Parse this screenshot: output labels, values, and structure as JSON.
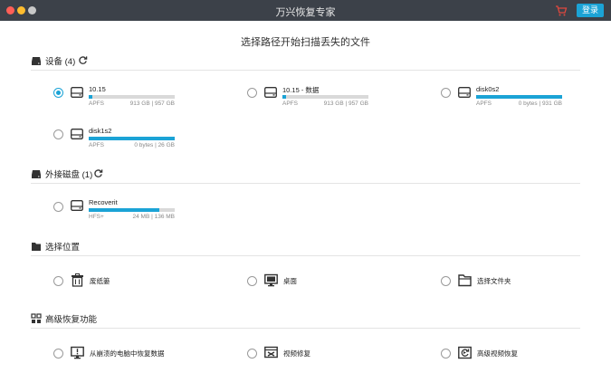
{
  "window": {
    "title": "万兴恢复专家",
    "login_label": "登录"
  },
  "page": {
    "heading": "选择路径开始扫描丢失的文件"
  },
  "sections": {
    "devices": {
      "label": "设备 (4)"
    },
    "external": {
      "label": "外接磁盘 (1)"
    },
    "locations": {
      "label": "选择位置"
    },
    "advanced": {
      "label": "高级恢复功能"
    }
  },
  "devices": [
    {
      "name": "10.15",
      "fs": "APFS",
      "size": "913 GB | 957 GB",
      "used_fraction": 0.04,
      "selected": true
    },
    {
      "name": "10.15 - 数据",
      "fs": "APFS",
      "size": "913 GB | 957 GB",
      "used_fraction": 0.04,
      "selected": false
    },
    {
      "name": "disk0s2",
      "fs": "APFS",
      "size": "0 bytes | 931 GB",
      "used_fraction": 1.0,
      "selected": false
    },
    {
      "name": "disk1s2",
      "fs": "APFS",
      "size": "0 bytes | 26 GB",
      "used_fraction": 1.0,
      "selected": false
    }
  ],
  "external": [
    {
      "name": "Recoverit",
      "fs": "HFS+",
      "size": "24 MB | 136 MB",
      "used_fraction": 0.82,
      "selected": false
    }
  ],
  "locations": [
    {
      "label": "废纸篓",
      "icon": "trash-icon"
    },
    {
      "label": "桌面",
      "icon": "desktop-icon"
    },
    {
      "label": "选择文件夹",
      "icon": "folder-icon"
    }
  ],
  "advanced": [
    {
      "label": "从崩溃的电脑中恢复数据",
      "icon": "crash-computer-icon"
    },
    {
      "label": "视频修复",
      "icon": "video-repair-icon"
    },
    {
      "label": "高级视频恢复",
      "icon": "advanced-video-icon"
    }
  ],
  "colors": {
    "accent": "#1ba3d6",
    "titlebar": "#3c4149",
    "bar_track": "#d9d9d9"
  }
}
